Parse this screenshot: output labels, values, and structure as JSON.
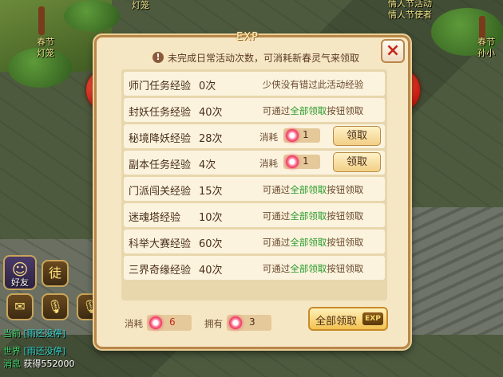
{
  "scene": {
    "npc_left_top": "灯笼",
    "npc_left_name1": "春节",
    "npc_left_name2": "灯笼",
    "npc_right_line1": "情人节活动",
    "npc_right_line2": "情人节使者",
    "npc_far_right1": "春节",
    "npc_far_right2": "孙小"
  },
  "hud": {
    "friends_label": "好友",
    "team_badge": "徒",
    "voice_world_label": "世"
  },
  "chat": [
    {
      "channel": "当前",
      "who": "[雨还没停]",
      "msg": ""
    },
    {
      "channel": "世界",
      "who": "[雨还没停]",
      "msg": ""
    },
    {
      "channel": "消息",
      "who": "",
      "msg": "获得552000"
    }
  ],
  "dialog": {
    "title": "EXP",
    "notice": "未完成日常活动次数，可消耗新春灵气来领取",
    "close_icon": "×",
    "rows": [
      {
        "name": "师门任务经验",
        "count": "0次",
        "type": "hint",
        "hint": "少侠没有错过此活动经验"
      },
      {
        "name": "封妖任务经验",
        "count": "40次",
        "type": "all",
        "hint_pre": "可通过",
        "hint_green": "全部领取",
        "hint_post": "按钮领取"
      },
      {
        "name": "秘境降妖经验",
        "count": "28次",
        "type": "claim",
        "cost_label": "消耗",
        "cost": "1",
        "button": "领取"
      },
      {
        "name": "副本任务经验",
        "count": "4次",
        "type": "claim",
        "cost_label": "消耗",
        "cost": "1",
        "button": "领取"
      },
      {
        "name": "门派闯关经验",
        "count": "15次",
        "type": "all",
        "hint_pre": "可通过",
        "hint_green": "全部领取",
        "hint_post": "按钮领取"
      },
      {
        "name": "迷魂塔经验",
        "count": "10次",
        "type": "all",
        "hint_pre": "可通过",
        "hint_green": "全部领取",
        "hint_post": "按钮领取"
      },
      {
        "name": "科举大赛经验",
        "count": "60次",
        "type": "all",
        "hint_pre": "可通过",
        "hint_green": "全部领取",
        "hint_post": "按钮领取"
      },
      {
        "name": "三界奇缘经验",
        "count": "40次",
        "type": "all",
        "hint_pre": "可通过",
        "hint_green": "全部领取",
        "hint_post": "按钮领取"
      }
    ],
    "footer": {
      "cost_label": "消耗",
      "cost_value": "6",
      "own_label": "拥有",
      "own_value": "3",
      "claim_all": "全部领取",
      "claim_all_badge": "EXP"
    }
  },
  "colors": {
    "accent_green": "#2a9a2a",
    "close_red": "#c5281c",
    "frame": "#b9874a"
  }
}
